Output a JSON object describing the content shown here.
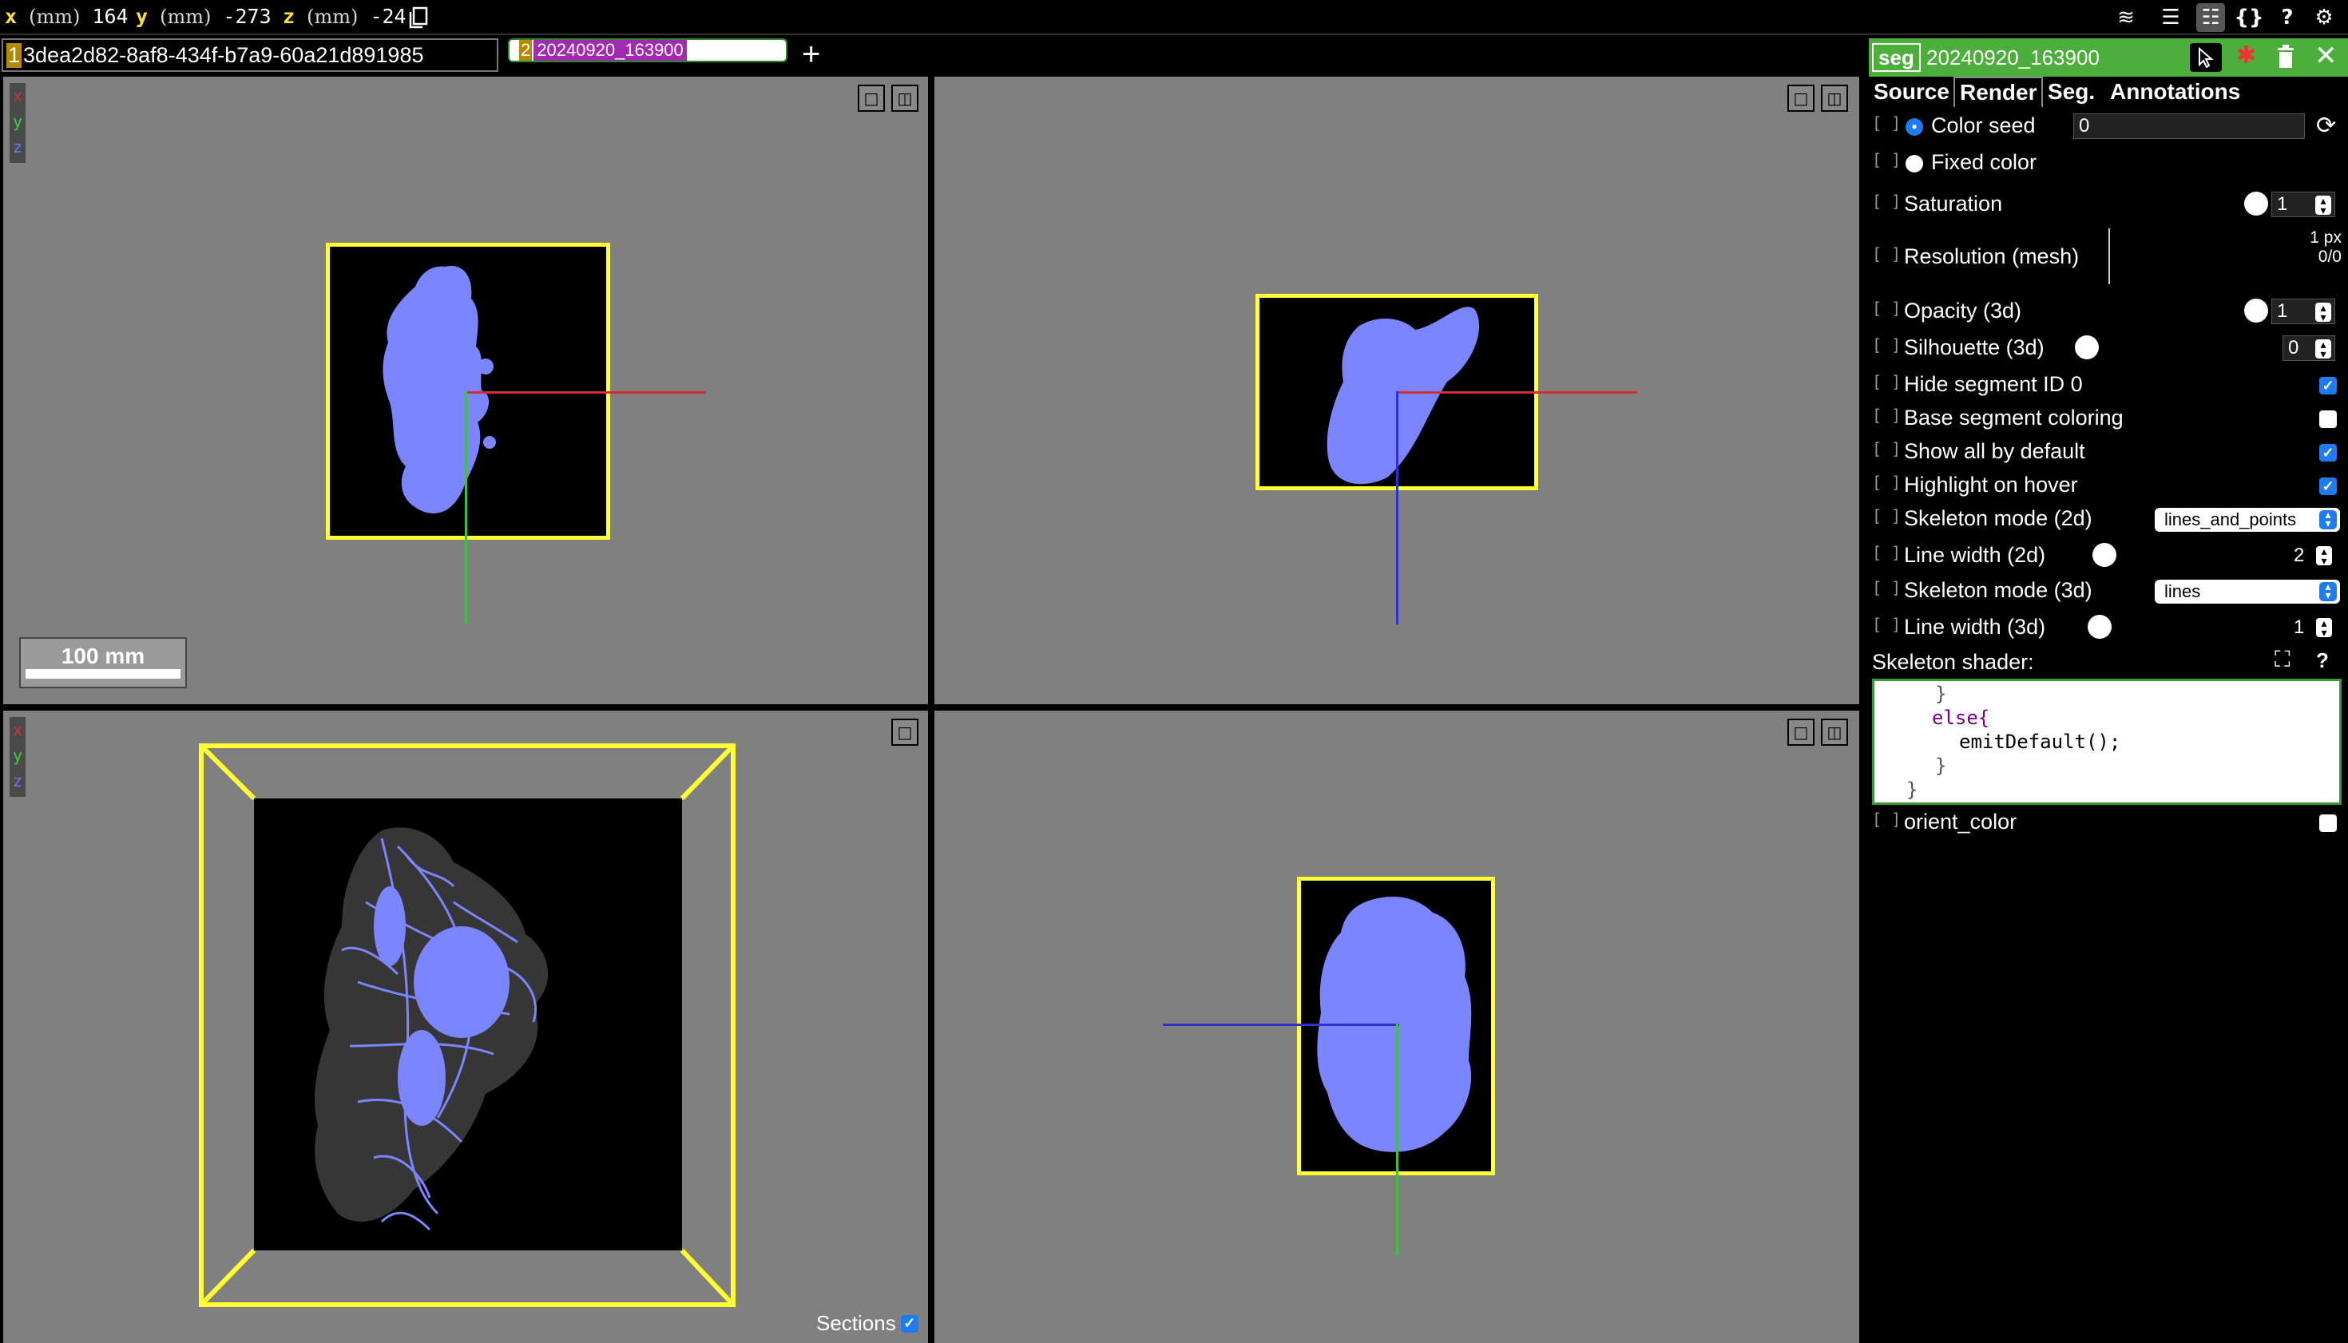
{
  "coords": {
    "x": {
      "axis": "x",
      "unit": "(mm)",
      "value": "164"
    },
    "y": {
      "axis": "y",
      "unit": "(mm)",
      "value": "-273"
    },
    "z": {
      "axis": "z",
      "unit": "(mm)",
      "value": "-24"
    }
  },
  "toolbar_icons": [
    "layers-icon",
    "list-icon",
    "settings-sliders-icon",
    "braces-icon",
    "help-icon",
    "gear-icon"
  ],
  "toolbar_glyphs": {
    "layers": "≋",
    "list": "☰",
    "sliders": "☷",
    "braces": "{}",
    "help": "?",
    "gear": "⚙"
  },
  "layers": [
    {
      "num": "1",
      "name": "3dea2d82-8af8-434f-b7a9-60a21d891985"
    },
    {
      "num": "2",
      "name": "20240920_163900"
    }
  ],
  "add_layer": "+",
  "axis_labels": {
    "x": "x",
    "y": "y",
    "z": "z"
  },
  "panel_buttons": {
    "maximize": "□",
    "split": "◫"
  },
  "scale_bar": "100 mm",
  "sections": {
    "label": "Sections",
    "checked": true
  },
  "segment_panel": {
    "type": "seg",
    "name": "20240920_163900",
    "tabs": [
      "Source",
      "Render",
      "Seg.",
      "Annotations"
    ],
    "active_tab": "Render",
    "bracket": "[ ]",
    "controls": {
      "color_seed": {
        "label": "Color seed",
        "value": "0"
      },
      "fixed_color": {
        "label": "Fixed color"
      },
      "saturation": {
        "label": "Saturation",
        "value": "1"
      },
      "resolution_mesh": {
        "label": "Resolution (mesh)",
        "value1": "1 px",
        "value2": "0/0"
      },
      "opacity_3d": {
        "label": "Opacity (3d)",
        "value": "1"
      },
      "silhouette_3d": {
        "label": "Silhouette (3d)",
        "value": "0"
      },
      "hide_segment_id0": {
        "label": "Hide segment ID 0",
        "checked": true
      },
      "base_segment_coloring": {
        "label": "Base segment coloring",
        "checked": false
      },
      "show_all_by_default": {
        "label": "Show all by default",
        "checked": true
      },
      "highlight_on_hover": {
        "label": "Highlight on hover",
        "checked": true
      },
      "skeleton_mode_2d": {
        "label": "Skeleton mode (2d)",
        "value": "lines_and_points"
      },
      "line_width_2d": {
        "label": "Line width (2d)",
        "value": "2"
      },
      "skeleton_mode_3d": {
        "label": "Skeleton mode (3d)",
        "value": "lines"
      },
      "line_width_3d": {
        "label": "Line width (3d)",
        "value": "1"
      },
      "skeleton_shader": {
        "label": "Skeleton shader:"
      },
      "orient_color": {
        "label": "orient_color",
        "checked": false
      }
    },
    "shader_lines": [
      "}",
      "else{",
      "emitDefault();",
      "}",
      "}"
    ]
  },
  "colors": {
    "segment_blue": "#7a85ff",
    "bbox_yellow": "#ffff33",
    "header_green": "#4caf3c",
    "panel_gray": "#808080"
  }
}
